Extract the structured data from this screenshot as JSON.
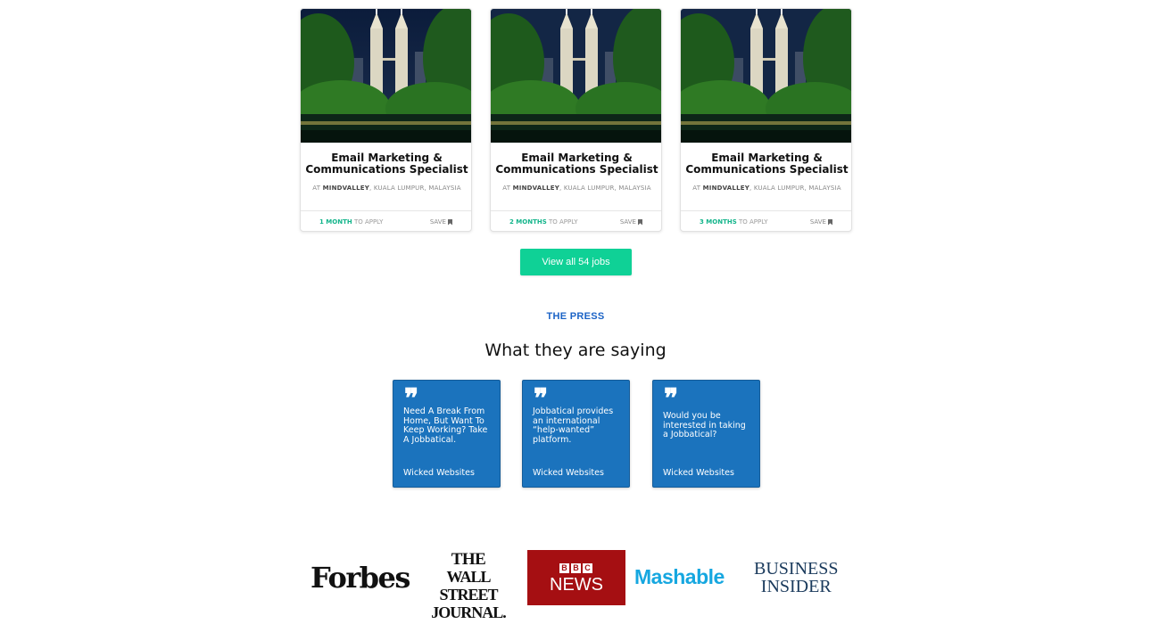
{
  "jobs": [
    {
      "title": "Email Marketing & Communications Specialist",
      "at": "AT",
      "company": "MINDVALLEY",
      "location": ", KUALA LUMPUR, MALAYSIA",
      "duration": "1 MONTH",
      "apply_suffix": " TO APPLY",
      "save_label": "SAVE"
    },
    {
      "title": "Email Marketing & Communications Specialist",
      "at": "AT",
      "company": "MINDVALLEY",
      "location": ", KUALA LUMPUR, MALAYSIA",
      "duration": "2 MONTHS",
      "apply_suffix": " TO APPLY",
      "save_label": "SAVE"
    },
    {
      "title": "Email Marketing & Communications Specialist",
      "at": "AT",
      "company": "MINDVALLEY",
      "location": ", KUALA LUMPUR, MALAYSIA",
      "duration": "3 MONTHS",
      "apply_suffix": " TO APPLY",
      "save_label": "SAVE"
    }
  ],
  "view_all_label": "View all 54 jobs",
  "press": {
    "label": "THE PRESS",
    "heading": "What they are saying",
    "quotes": [
      {
        "text": "Need A Break From Home, But Want To Keep Working? Take A Jobbatical.",
        "source": "Wicked Websites"
      },
      {
        "text": "Jobbatical provides an international “help-wanted” platform.",
        "source": "Wicked Websites"
      },
      {
        "text": "Would you be interested in taking a Jobbatical?",
        "source": "Wicked Websites"
      }
    ]
  },
  "logos": {
    "forbes": "Forbes",
    "wsj": [
      "THE",
      "WALL STREET",
      "JOURNAL."
    ],
    "bbc_letters": [
      "B",
      "B",
      "C"
    ],
    "bbc_news": "NEWS",
    "mashable": "Mashable",
    "business_insider": [
      "BUSINESS",
      "INSIDER"
    ]
  },
  "colors": {
    "accent_green": "#0fd196",
    "press_blue": "#1b63c6",
    "quote_blue": "#1b73bd",
    "bbc_red": "#a50f12",
    "mashable_blue": "#16a7e0"
  },
  "icons": {
    "job_photo": "kuala-lumpur-twin-towers-photo",
    "save": "bookmark-icon",
    "quote": "quote-mark-icon"
  }
}
